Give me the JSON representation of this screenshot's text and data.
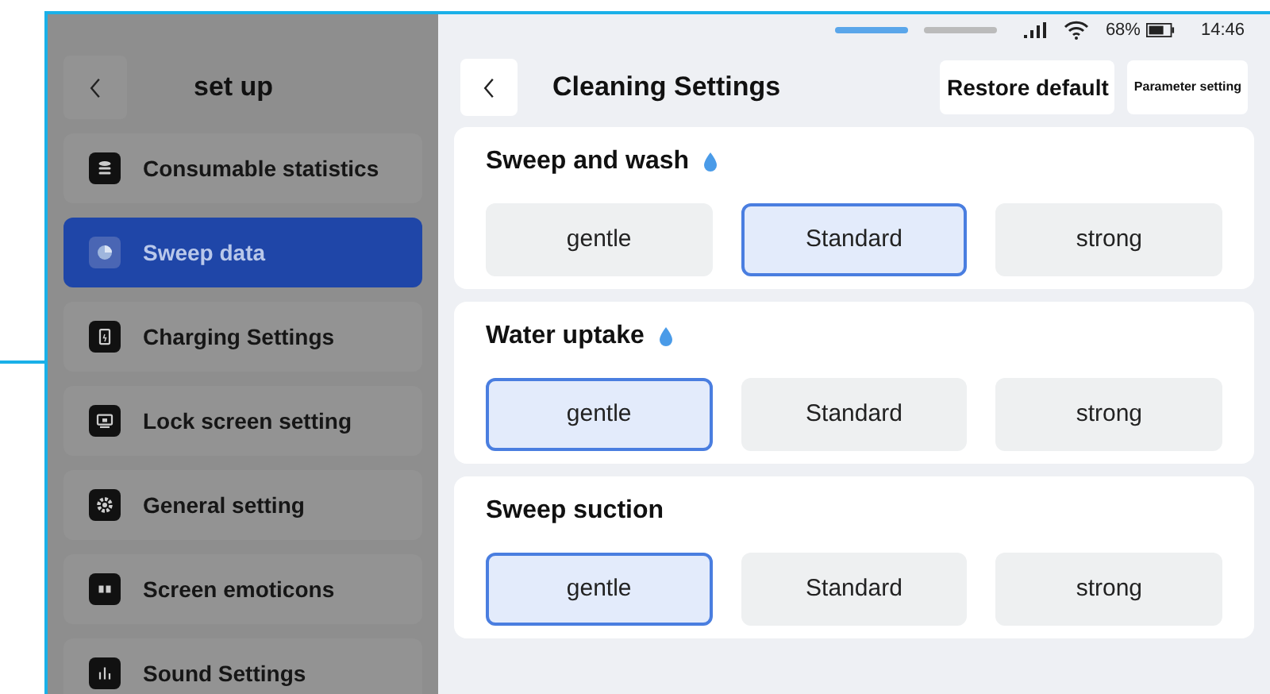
{
  "sidebar": {
    "title": "set up",
    "items": [
      {
        "label": "Consumable statistics",
        "selected": false
      },
      {
        "label": "Sweep data",
        "selected": true
      },
      {
        "label": "Charging Settings",
        "selected": false
      },
      {
        "label": "Lock screen setting",
        "selected": false
      },
      {
        "label": "General setting",
        "selected": false
      },
      {
        "label": "Screen emoticons",
        "selected": false
      },
      {
        "label": "Sound Settings",
        "selected": false
      }
    ]
  },
  "status_bar": {
    "battery": "68%",
    "time": "14:46"
  },
  "header": {
    "title": "Cleaning Settings",
    "actions": [
      "Restore default",
      "Parameter setting"
    ]
  },
  "sections": [
    {
      "title": "Sweep and wash",
      "water_icon": true,
      "options": [
        {
          "label": "gentle",
          "selected": false
        },
        {
          "label": "Standard",
          "selected": true
        },
        {
          "label": "strong",
          "selected": false
        }
      ]
    },
    {
      "title": "Water uptake",
      "water_icon": true,
      "options": [
        {
          "label": "gentle",
          "selected": true
        },
        {
          "label": "Standard",
          "selected": false
        },
        {
          "label": "strong",
          "selected": false
        }
      ]
    },
    {
      "title": "Sweep suction",
      "water_icon": false,
      "options": [
        {
          "label": "gentle",
          "selected": true
        },
        {
          "label": "Standard",
          "selected": false
        },
        {
          "label": "strong",
          "selected": false
        }
      ]
    }
  ]
}
